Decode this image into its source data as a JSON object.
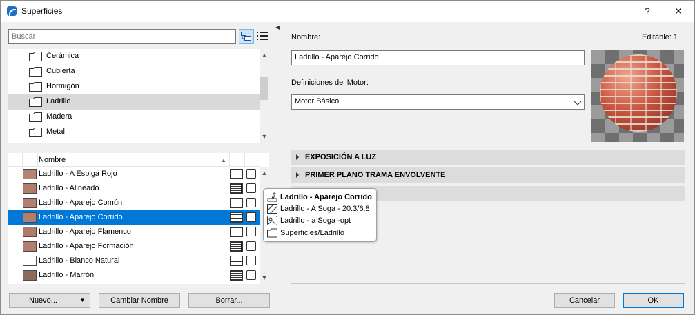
{
  "window": {
    "title": "Superficies",
    "help": "?",
    "close": "✕"
  },
  "search": {
    "placeholder": "Buscar"
  },
  "folders": {
    "items": [
      "Cerámica",
      "Cubierta",
      "Hormigón",
      "Ladrillo",
      "Madera",
      "Metal"
    ],
    "selected": "Ladrillo"
  },
  "list": {
    "header": "Nombre",
    "items": [
      {
        "name": "Ladrillo - A Espiga Rojo",
        "color": "#b78372"
      },
      {
        "name": "Ladrillo - Alineado",
        "color": "#b27d6c"
      },
      {
        "name": "Ladrillo - Aparejo Común",
        "color": "#b58070"
      },
      {
        "name": "Ladrillo - Aparejo Corrido",
        "color": "#b27e6e"
      },
      {
        "name": "Ladrillo - Aparejo Flamenco",
        "color": "#b07b6b"
      },
      {
        "name": "Ladrillo - Aparejo Formación",
        "color": "#b27e6e"
      },
      {
        "name": "Ladrillo - Blanco Natural",
        "color": "#ffffff"
      },
      {
        "name": "Ladrillo - Marrón",
        "color": "#8c6b5d"
      }
    ],
    "selected": "Ladrillo - Aparejo Corrido"
  },
  "buttons": {
    "new": "Nuevo...",
    "rename": "Cambiar Nombre",
    "delete": "Borrar...",
    "cancel": "Cancelar",
    "ok": "OK"
  },
  "details": {
    "name_label": "Nombre:",
    "editable": "Editable: 1",
    "name_value": "Ladrillo - Aparejo Corrido",
    "engine_label": "Definiciones del Motor:",
    "engine_value": "Motor Básico",
    "sections": [
      "EXPOSICIÓN A LUZ",
      "PRIMER PLANO TRAMA ENVOLVENTE"
    ]
  },
  "tooltip": {
    "surface": "Ladrillo - Aparejo Corrido",
    "fill": "Ladrillo - A Soga - 20.3/6.8",
    "texture": "Ladrillo - a Soga -opt",
    "folder": "Superficies/Ladrillo"
  },
  "colors": {
    "accent": "#0078d7",
    "selected_folder": "#d9d9d9"
  }
}
